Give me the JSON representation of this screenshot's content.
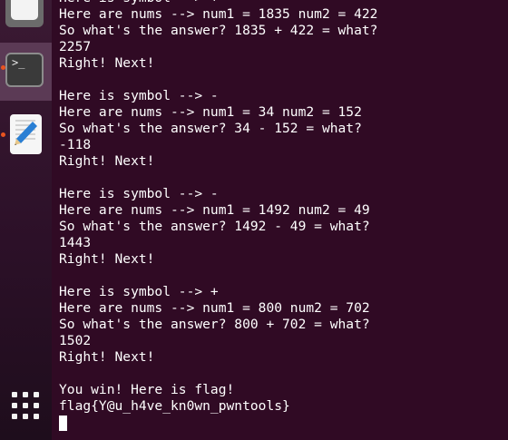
{
  "dock": {
    "items": [
      {
        "name": "files",
        "icon": "folder-icon"
      },
      {
        "name": "terminal",
        "icon": "terminal-icon",
        "glyph": ">_",
        "active": true
      },
      {
        "name": "text-editor",
        "icon": "pencil-notepad-icon"
      }
    ],
    "show_apps_icon": "apps-grid-icon"
  },
  "terminal": {
    "lines": [
      "Here is symbol --> +",
      "Here are nums --> num1 = 1835 num2 = 422",
      "So what's the answer? 1835 + 422 = what?",
      "2257",
      "Right! Next!",
      "",
      "Here is symbol --> -",
      "Here are nums --> num1 = 34 num2 = 152",
      "So what's the answer? 34 - 152 = what?",
      "-118",
      "Right! Next!",
      "",
      "Here is symbol --> -",
      "Here are nums --> num1 = 1492 num2 = 49",
      "So what's the answer? 1492 - 49 = what?",
      "1443",
      "Right! Next!",
      "",
      "Here is symbol --> +",
      "Here are nums --> num1 = 800 num2 = 702",
      "So what's the answer? 800 + 702 = what?",
      "1502",
      "Right! Next!",
      "",
      "You win! Here is flag!",
      "flag{Y@u_h4ve_kn0wn_pwntools}"
    ]
  },
  "colors": {
    "terminal_bg": "#300a24",
    "text": "#ffffff",
    "dock_active": "#5b3a55",
    "running_indicator": "#e95420"
  }
}
